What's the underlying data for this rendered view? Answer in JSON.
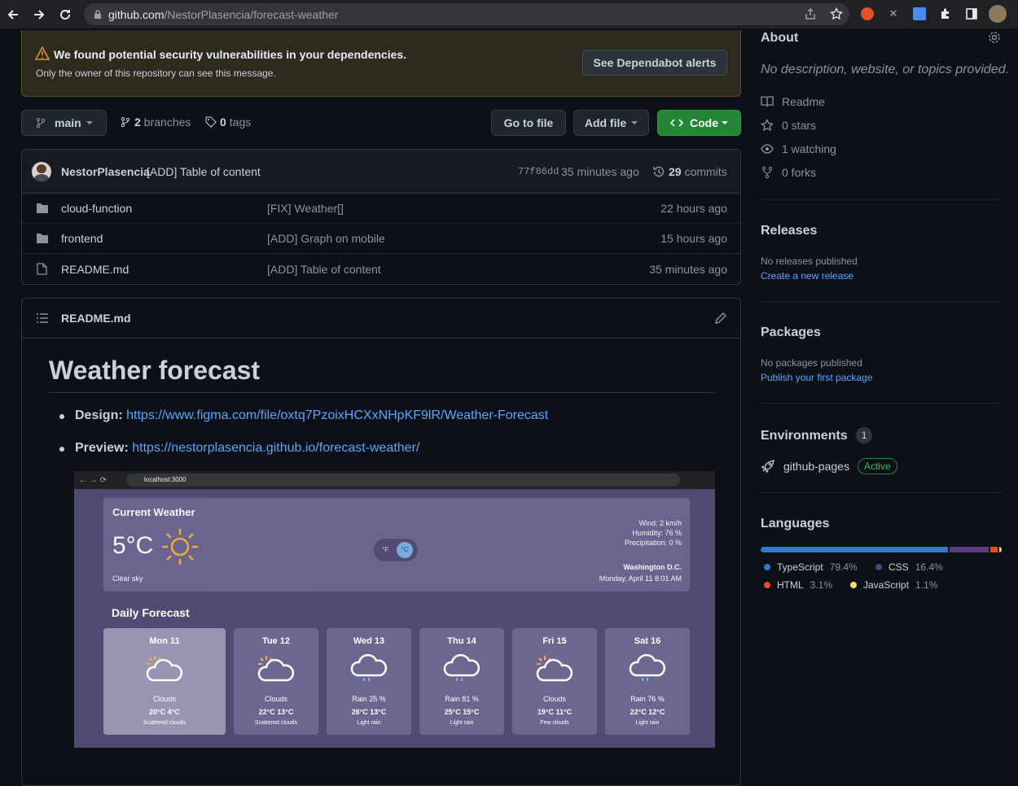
{
  "browser": {
    "url_host": "github.com",
    "url_path": "/NestorPlasencia/forecast-weather"
  },
  "banner": {
    "title": "We found potential security vulnerabilities in your dependencies.",
    "subtitle": "Only the owner of this repository can see this message.",
    "button": "See Dependabot alerts"
  },
  "toolbar": {
    "branch": "main",
    "branches_count": "2",
    "branches_label": "branches",
    "tags_count": "0",
    "tags_label": "tags",
    "go_to_file": "Go to file",
    "add_file": "Add file",
    "code": "Code"
  },
  "commit": {
    "author": "NestorPlasencia",
    "message": "[ADD] Table of content",
    "hash": "77f86dd",
    "time": "35 minutes ago",
    "count": "29",
    "count_label": "commits"
  },
  "files": [
    {
      "name": "cloud-function",
      "type": "folder",
      "message": "[FIX] Weather[]",
      "time": "22 hours ago"
    },
    {
      "name": "frontend",
      "type": "folder",
      "message": "[ADD] Graph on mobile",
      "time": "15 hours ago"
    },
    {
      "name": "README.md",
      "type": "file",
      "message": "[ADD] Table of content",
      "time": "35 minutes ago"
    }
  ],
  "readme": {
    "header": "README.md",
    "title": "Weather forecast",
    "design_label": "Design:",
    "design_link": "https://www.figma.com/file/oxtq7PzoixHCXxNHpKF9lR/Weather-Forecast",
    "preview_label": "Preview:",
    "preview_link": "https://nestorplasencia.github.io/forecast-weather/"
  },
  "preview": {
    "url": "localhost:3000",
    "current_title": "Current Weather",
    "temp": "5°C",
    "desc": "Clear sky",
    "wind": "Wind:   2 km/h",
    "humidity": "Humidity:   76 %",
    "precip": "Precipitation:   0 %",
    "location": "Washington D.C.",
    "datetime": "Monday, April 11 8:01 AM",
    "unit_f": "°F",
    "unit_c": "°C",
    "daily_title": "Daily Forecast",
    "days": [
      {
        "name": "Mon 11",
        "cond": "Clouds",
        "temps": "20°C   4°C",
        "sub": "Scattered clouds"
      },
      {
        "name": "Tue 12",
        "cond": "Clouds",
        "temps": "22°C   13°C",
        "sub": "Scattered clouds"
      },
      {
        "name": "Wed 13",
        "cond": "Rain   25 %",
        "temps": "26°C   13°C",
        "sub": "Light rain"
      },
      {
        "name": "Thu 14",
        "cond": "Rain   81 %",
        "temps": "25°C   15°C",
        "sub": "Light rain"
      },
      {
        "name": "Fri 15",
        "cond": "Clouds",
        "temps": "19°C   11°C",
        "sub": "Few clouds"
      },
      {
        "name": "Sat 16",
        "cond": "Rain   76 %",
        "temps": "22°C   12°C",
        "sub": "Light rain"
      }
    ]
  },
  "sidebar": {
    "about_title": "About",
    "about_desc": "No description, website, or topics provided.",
    "readme": "Readme",
    "stars": "0 stars",
    "watching": "1 watching",
    "forks": "0 forks",
    "releases_title": "Releases",
    "releases_none": "No releases published",
    "releases_link": "Create a new release",
    "packages_title": "Packages",
    "packages_none": "No packages published",
    "packages_link": "Publish your first package",
    "env_title": "Environments",
    "env_count": "1",
    "env_name": "github-pages",
    "env_status": "Active",
    "lang_title": "Languages",
    "languages": [
      {
        "name": "TypeScript",
        "pct": "79.4%",
        "value": 79.4,
        "color": "#3178c6"
      },
      {
        "name": "CSS",
        "pct": "16.4%",
        "value": 16.4,
        "color": "#563d7c"
      },
      {
        "name": "HTML",
        "pct": "3.1%",
        "value": 3.1,
        "color": "#e34c26"
      },
      {
        "name": "JavaScript",
        "pct": "1.1%",
        "value": 1.1,
        "color": "#f1e05a"
      }
    ]
  },
  "colors": {
    "accent_green": "#238636",
    "link": "#58a6ff"
  }
}
